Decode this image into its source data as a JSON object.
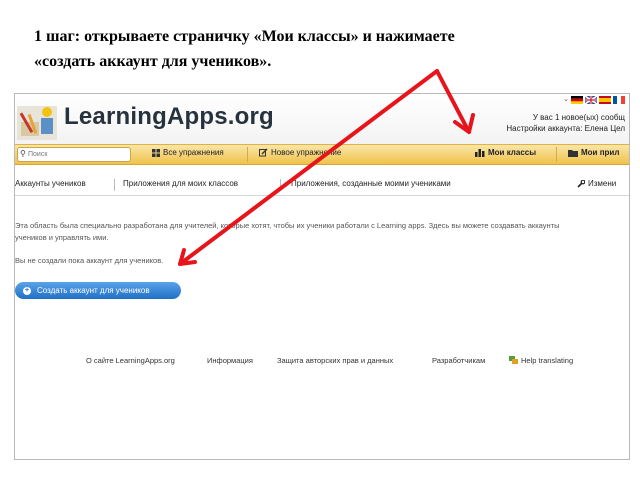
{
  "instruction": {
    "line1": "1 шаг: открываете страничку «Мои классы» и нажимаете",
    "line2": "«создать аккаунт для учеников»."
  },
  "header": {
    "logo": "LearningApps.org",
    "messages": "У вас 1 новое(ых) сообщ",
    "account": "Настройки аккаунта: Елена Цел"
  },
  "toolbar": {
    "search_placeholder": "Поиск",
    "all_exercises": "Все упражнения",
    "new_exercise": "Новое упражнение",
    "my_classes": "Мои классы",
    "my_apps": "Мои прил"
  },
  "tabs": {
    "accounts": "Аккаунты учеников",
    "class_apps": "Приложения для моих классов",
    "student_apps": "Приложения, созданные моими учениками",
    "edit": "Измени"
  },
  "content": {
    "desc_line1": "Эта область была специально разработана для учителей, которые хотят, чтобы их ученики работали с Learning apps. Здесь вы можете создавать аккаунты",
    "desc_line2": "учеников и управлять ими.",
    "empty": "Вы не создали пока аккаунт для учеников.",
    "create_button": "Создать аккаунт для учеников"
  },
  "footer": {
    "about": "О сайте LearningApps.org",
    "info": "Информация",
    "privacy": "Защита авторских прав и данных",
    "developers": "Разработчикам",
    "help": "Help translating"
  },
  "colors": {
    "arrow": "#e8141c",
    "toolbar": "#f0c24a",
    "button": "#1f6fc6"
  }
}
